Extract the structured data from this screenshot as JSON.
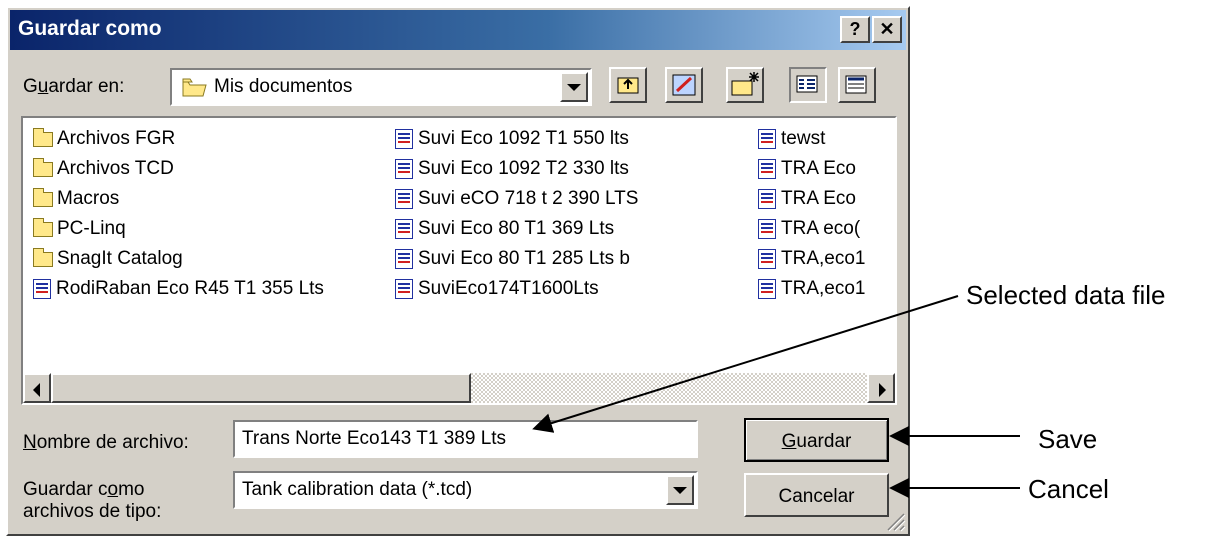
{
  "dialog": {
    "title": "Guardar como",
    "help_glyph": "?",
    "close_glyph": "✕"
  },
  "location": {
    "label_pre": "G",
    "label_u": "u",
    "label_post": "ardar en:",
    "value": "Mis documentos"
  },
  "files": {
    "col1": [
      {
        "name": "Archivos FGR",
        "icon": "folder-icon"
      },
      {
        "name": "Archivos TCD",
        "icon": "folder-icon"
      },
      {
        "name": "Macros",
        "icon": "folder-icon"
      },
      {
        "name": "PC-Linq",
        "icon": "folder-icon"
      },
      {
        "name": "SnagIt Catalog",
        "icon": "folder-icon"
      },
      {
        "name": "RodiRaban Eco R45 T1 355 Lts",
        "icon": "data-file-icon"
      }
    ],
    "col2": [
      {
        "name": "Suvi Eco 1092 T1 550 lts",
        "icon": "data-file-icon"
      },
      {
        "name": "Suvi Eco 1092 T2 330 lts",
        "icon": "data-file-icon"
      },
      {
        "name": "Suvi eCO 718 t 2 390 LTS",
        "icon": "data-file-icon"
      },
      {
        "name": "Suvi Eco 80 T1  369 Lts",
        "icon": "data-file-icon"
      },
      {
        "name": "Suvi Eco 80 T1 285 Lts b",
        "icon": "data-file-icon"
      },
      {
        "name": "SuviEco174T1600Lts",
        "icon": "data-file-icon"
      }
    ],
    "col3": [
      {
        "name": "tewst",
        "icon": "data-file-icon"
      },
      {
        "name": "TRA Eco",
        "icon": "data-file-icon"
      },
      {
        "name": "TRA Eco",
        "icon": "data-file-icon"
      },
      {
        "name": "TRA eco(",
        "icon": "data-file-icon"
      },
      {
        "name": "TRA,eco1",
        "icon": "data-file-icon"
      },
      {
        "name": "TRA,eco1",
        "icon": "data-file-icon"
      }
    ]
  },
  "filename": {
    "label_u": "N",
    "label_post": "ombre de archivo:",
    "value": "Trans Norte Eco143 T1 389 Lts"
  },
  "filetype": {
    "label_line1_pre": "Guardar c",
    "label_line1_u": "o",
    "label_line1_post": "mo",
    "label_line2": "archivos de tipo:",
    "value": "Tank calibration data (*.tcd)"
  },
  "buttons": {
    "save_u": "G",
    "save_post": "uardar",
    "cancel": "Cancelar"
  },
  "annotations": {
    "selected": "Selected data file",
    "save": "Save",
    "cancel": "Cancel"
  },
  "colors": {
    "titlebar_start": "#0a246a",
    "titlebar_end": "#a6caf0",
    "face": "#d4d0c8"
  }
}
